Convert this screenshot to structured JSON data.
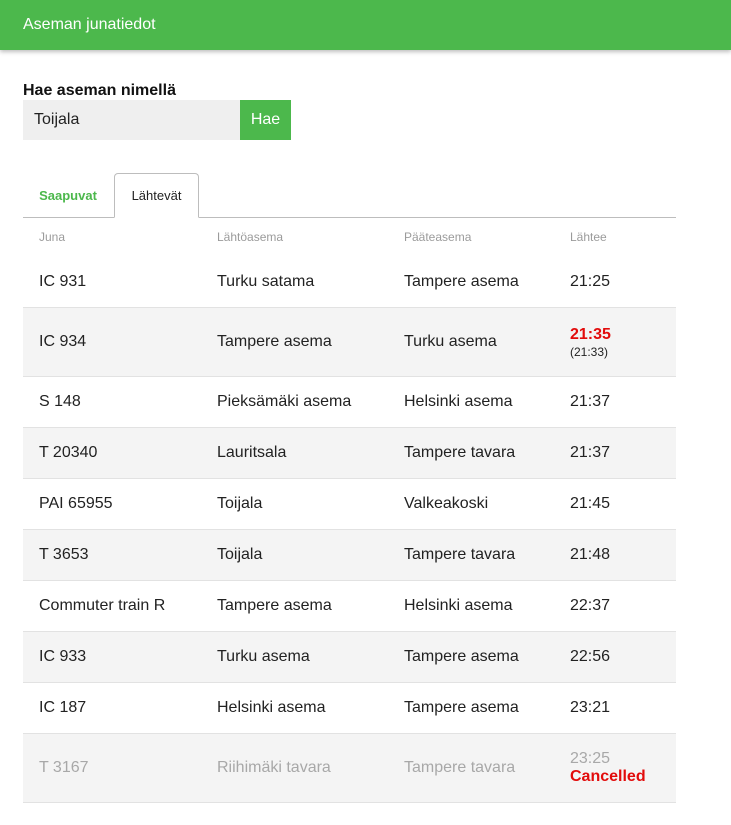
{
  "header": {
    "title": "Aseman junatiedot"
  },
  "search": {
    "label": "Hae aseman nimellä",
    "value": "Toijala",
    "button_label": "Hae"
  },
  "tabs": [
    {
      "label": "Saapuvat",
      "active": false
    },
    {
      "label": "Lähtevät",
      "active": true
    }
  ],
  "table": {
    "columns": [
      "Juna",
      "Lähtöasema",
      "Pääteasema",
      "Lähtee"
    ],
    "rows": [
      {
        "train": "IC 931",
        "origin": "Turku satama",
        "destination": "Tampere asema",
        "time": "21:25"
      },
      {
        "train": "IC 934",
        "origin": "Tampere asema",
        "destination": "Turku asema",
        "time": "21:35",
        "original_time": "(21:33)"
      },
      {
        "train": "S 148",
        "origin": "Pieksämäki asema",
        "destination": "Helsinki asema",
        "time": "21:37"
      },
      {
        "train": "T 20340",
        "origin": "Lauritsala",
        "destination": "Tampere tavara",
        "time": "21:37"
      },
      {
        "train": "PAI 65955",
        "origin": "Toijala",
        "destination": "Valkeakoski",
        "time": "21:45"
      },
      {
        "train": "T 3653",
        "origin": "Toijala",
        "destination": "Tampere tavara",
        "time": "21:48"
      },
      {
        "train": "Commuter train R",
        "origin": "Tampere asema",
        "destination": "Helsinki asema",
        "time": "22:37"
      },
      {
        "train": "IC 933",
        "origin": "Turku asema",
        "destination": "Tampere asema",
        "time": "22:56"
      },
      {
        "train": "IC 187",
        "origin": "Helsinki asema",
        "destination": "Tampere asema",
        "time": "23:21"
      },
      {
        "train": "T 3167",
        "origin": "Riihimäki tavara",
        "destination": "Tampere tavara",
        "time": "23:25",
        "status": "Cancelled"
      }
    ]
  },
  "colors": {
    "accent": "#4cb84c",
    "alert": "#e20b0b"
  }
}
